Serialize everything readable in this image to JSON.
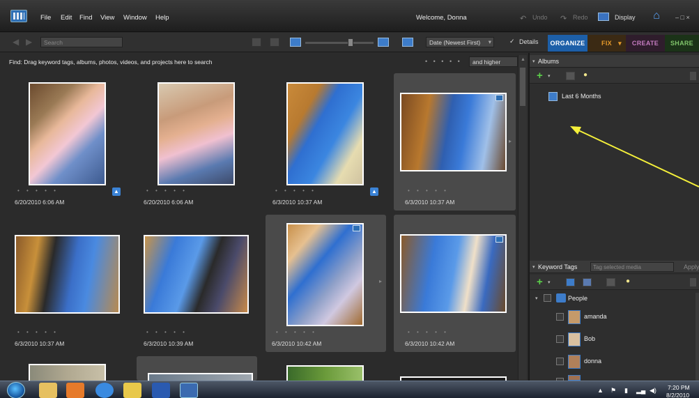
{
  "menubar": {
    "menus": [
      "File",
      "Edit",
      "Find",
      "View",
      "Window",
      "Help"
    ],
    "welcome": "Welcome, Donna",
    "undo": "Undo",
    "redo": "Redo",
    "display": "Display",
    "window_controls": "– □ ×"
  },
  "toolbar": {
    "search_placeholder": "Search",
    "sort_value": "Date (Newest First)",
    "details_check": "✓",
    "details_label": "Details"
  },
  "tabs": {
    "organize": "ORGANIZE",
    "fix": "FIX",
    "create": "CREATE",
    "share": "SHARE"
  },
  "find": {
    "text": "Find: Drag keyword tags, albums, photos, videos, and projects here to search",
    "stars": "• • • • •",
    "rating": "and higher"
  },
  "media": [
    {
      "date": "6/20/2010 6:06 AM",
      "stars": "• • • • •"
    },
    {
      "date": "6/20/2010 6:06 AM",
      "stars": "• • • • •"
    },
    {
      "date": "6/3/2010 10:37 AM",
      "stars": "• • • • •"
    },
    {
      "date": "6/3/2010 10:37 AM",
      "stars": "• • • • •"
    },
    {
      "date": "6/3/2010 10:37 AM",
      "stars": "• • • • •"
    },
    {
      "date": "6/3/2010 10:39 AM",
      "stars": "• • • • •"
    },
    {
      "date": "6/3/2010 10:42 AM",
      "stars": "• • • • •"
    },
    {
      "date": "6/3/2010 10:42 AM",
      "stars": "• • • • •"
    }
  ],
  "albums": {
    "title": "Albums",
    "items": [
      "Last 6 Months"
    ]
  },
  "keywords": {
    "title": "Keyword Tags",
    "placeholder": "Tag selected media",
    "apply": "Apply",
    "category": "People",
    "people": [
      "amanda",
      "Bob",
      "donna"
    ]
  },
  "taskbar": {
    "time": "7:20 PM",
    "date": "8/2/2010"
  },
  "colors": {
    "accent": "#1d5fa8",
    "annotation_arrow": "#f5f03a"
  }
}
